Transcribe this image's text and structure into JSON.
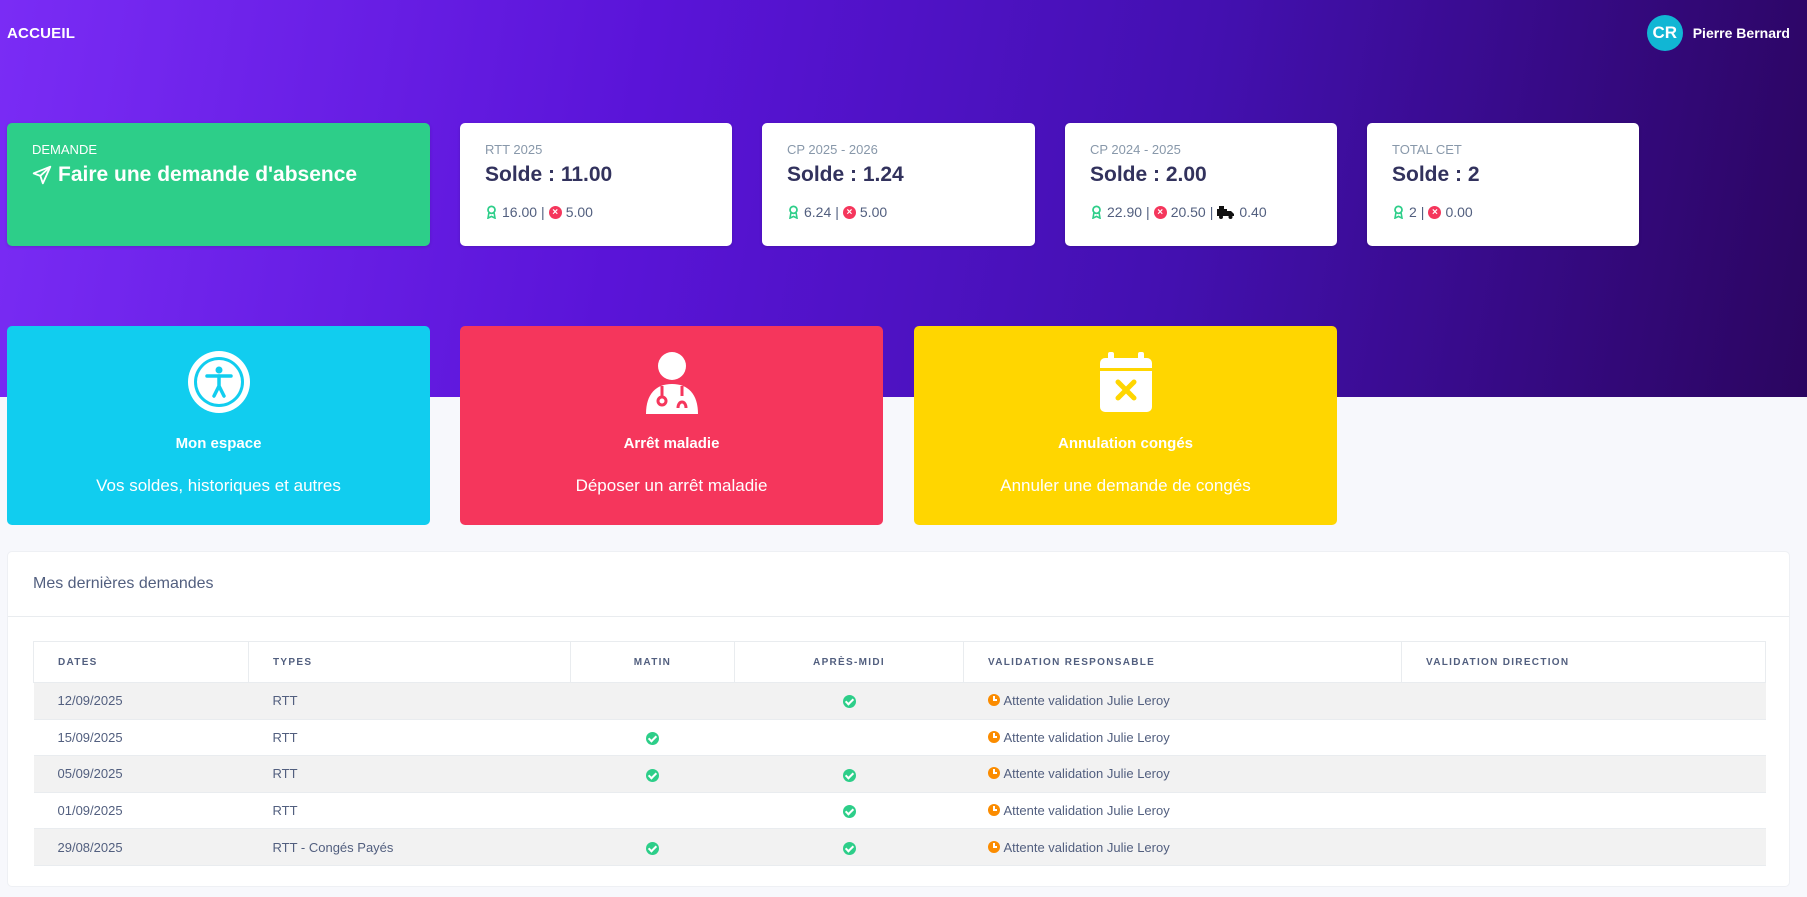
{
  "header": {
    "title": "ACCUEIL",
    "user_initials": "CR",
    "user_name": "Pierre Bernard"
  },
  "colors": {
    "accent_green": "#2dce89",
    "accent_red": "#f5365c",
    "cyan": "#11cdef",
    "yellow": "#ffd600",
    "purple": "#6a1ee0"
  },
  "demande": {
    "label": "DEMANDE",
    "title": "Faire une demande d'absence",
    "icon": "paper-plane-icon"
  },
  "balances": [
    {
      "label": "RTT 2025",
      "solde": "Solde : 11.00",
      "acquired": "16.00",
      "taken": "5.00"
    },
    {
      "label": "CP 2025 - 2026",
      "solde": "Solde : 1.24",
      "acquired": "6.24",
      "taken": "5.00"
    },
    {
      "label": "CP 2024 - 2025",
      "solde": "Solde : 2.00",
      "acquired": "22.90",
      "taken": "20.50",
      "transferred": "0.40"
    },
    {
      "label": "TOTAL CET",
      "solde": "Solde : 2",
      "acquired": "2",
      "taken": "0.00"
    }
  ],
  "actions": [
    {
      "title": "Mon espace",
      "desc": "Vos soldes, historiques et autres",
      "icon": "accessibility-icon",
      "color": "#11cdef"
    },
    {
      "title": "Arrêt maladie",
      "desc": "Déposer un arrêt maladie",
      "icon": "doctor-icon",
      "color": "#f5365c"
    },
    {
      "title": "Annulation congés",
      "desc": "Annuler une demande de congés",
      "icon": "calendar-x-icon",
      "color": "#ffd600"
    }
  ],
  "requests": {
    "title": "Mes dernières demandes",
    "columns": [
      "DATES",
      "TYPES",
      "MATIN",
      "APRÈS-MIDI",
      "VALIDATION RESPONSABLE",
      "VALIDATION DIRECTION"
    ],
    "rows": [
      {
        "date": "12/09/2025",
        "type": "RTT",
        "matin": false,
        "apres_midi": true,
        "validation_responsable": "Attente validation Julie Leroy",
        "validation_direction": ""
      },
      {
        "date": "15/09/2025",
        "type": "RTT",
        "matin": true,
        "apres_midi": false,
        "validation_responsable": "Attente validation Julie Leroy",
        "validation_direction": ""
      },
      {
        "date": "05/09/2025",
        "type": "RTT",
        "matin": true,
        "apres_midi": true,
        "validation_responsable": "Attente validation Julie Leroy",
        "validation_direction": ""
      },
      {
        "date": "01/09/2025",
        "type": "RTT",
        "matin": false,
        "apres_midi": true,
        "validation_responsable": "Attente validation Julie Leroy",
        "validation_direction": ""
      },
      {
        "date": "29/08/2025",
        "type": "RTT - Congés Payés",
        "matin": true,
        "apres_midi": true,
        "validation_responsable": "Attente validation Julie Leroy",
        "validation_direction": ""
      }
    ]
  }
}
